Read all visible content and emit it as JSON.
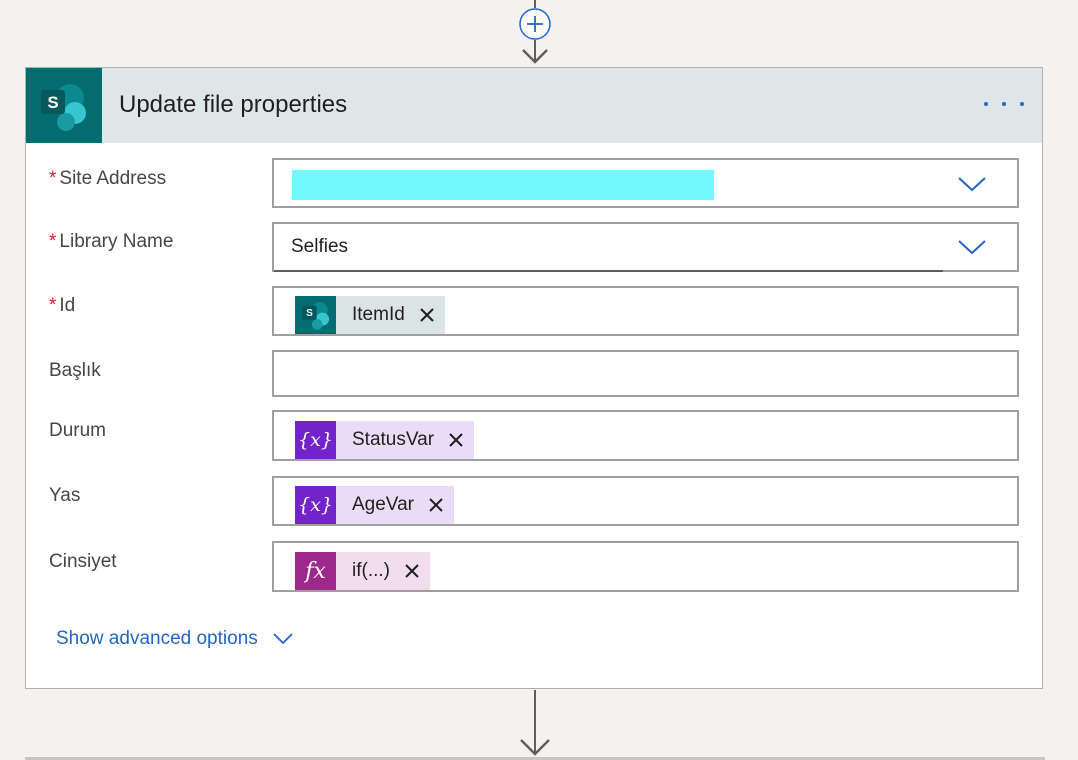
{
  "card": {
    "title": "Update file properties",
    "app_icon_letter": "S",
    "accent": "#036c70"
  },
  "fields": [
    {
      "label": "Site Address",
      "required": "*",
      "value": ""
    },
    {
      "label": "Library Name",
      "required": "*",
      "value": "Selfies"
    },
    {
      "label": "Id",
      "required": "*",
      "token": "ItemId",
      "token_icon_letter": "S"
    },
    {
      "label": "Başlık",
      "value": ""
    },
    {
      "label": "Durum",
      "token": "StatusVar",
      "token_icon": "{x}"
    },
    {
      "label": "Yas",
      "token": "AgeVar",
      "token_icon": "{x}"
    },
    {
      "label": "Cinsiyet",
      "token": "if(...)",
      "token_icon": "fx"
    }
  ],
  "advanced": {
    "label": "Show advanced options"
  },
  "icons": {
    "more": "more-options-icon",
    "insert": "plus-circle-icon",
    "arrow": "arrow-down-icon",
    "chevron": "chevron-down-icon",
    "close": "close-icon"
  }
}
